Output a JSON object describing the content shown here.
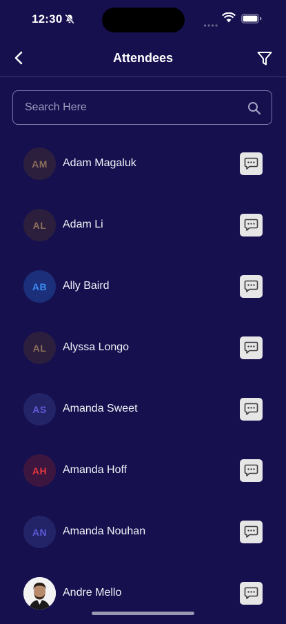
{
  "status_bar": {
    "time": "12:30"
  },
  "nav": {
    "title": "Attendees",
    "back_icon": "chevron-left-icon",
    "filter_icon": "filter-icon"
  },
  "search": {
    "placeholder": "Search Here",
    "value": ""
  },
  "attendees": [
    {
      "name": "Adam Magaluk",
      "initials": "AM",
      "avatar_bg": "#2c1f3e",
      "initials_color": "#8b6e5a",
      "photo": false
    },
    {
      "name": "Adam Li",
      "initials": "AL",
      "avatar_bg": "#2c1f3e",
      "initials_color": "#8b6e5a",
      "photo": false
    },
    {
      "name": "Ally Baird",
      "initials": "AB",
      "avatar_bg": "#1c2f7a",
      "initials_color": "#3b8bf2",
      "photo": false
    },
    {
      "name": "Alyssa Longo",
      "initials": "AL",
      "avatar_bg": "#2c1f3e",
      "initials_color": "#8b6e5a",
      "photo": false
    },
    {
      "name": "Amanda Sweet",
      "initials": "AS",
      "avatar_bg": "#232368",
      "initials_color": "#5f5cd6",
      "photo": false
    },
    {
      "name": "Amanda Hoff",
      "initials": "AH",
      "avatar_bg": "#3d1640",
      "initials_color": "#e0383e",
      "photo": false
    },
    {
      "name": "Amanda Nouhan",
      "initials": "AN",
      "avatar_bg": "#232368",
      "initials_color": "#5c5ad8",
      "photo": false
    },
    {
      "name": "Andre Mello",
      "initials": "",
      "avatar_bg": "#f2f2f2",
      "initials_color": "#000000",
      "photo": true
    }
  ],
  "colors": {
    "background": "#16104f",
    "message_button": "#e6e6e6"
  }
}
